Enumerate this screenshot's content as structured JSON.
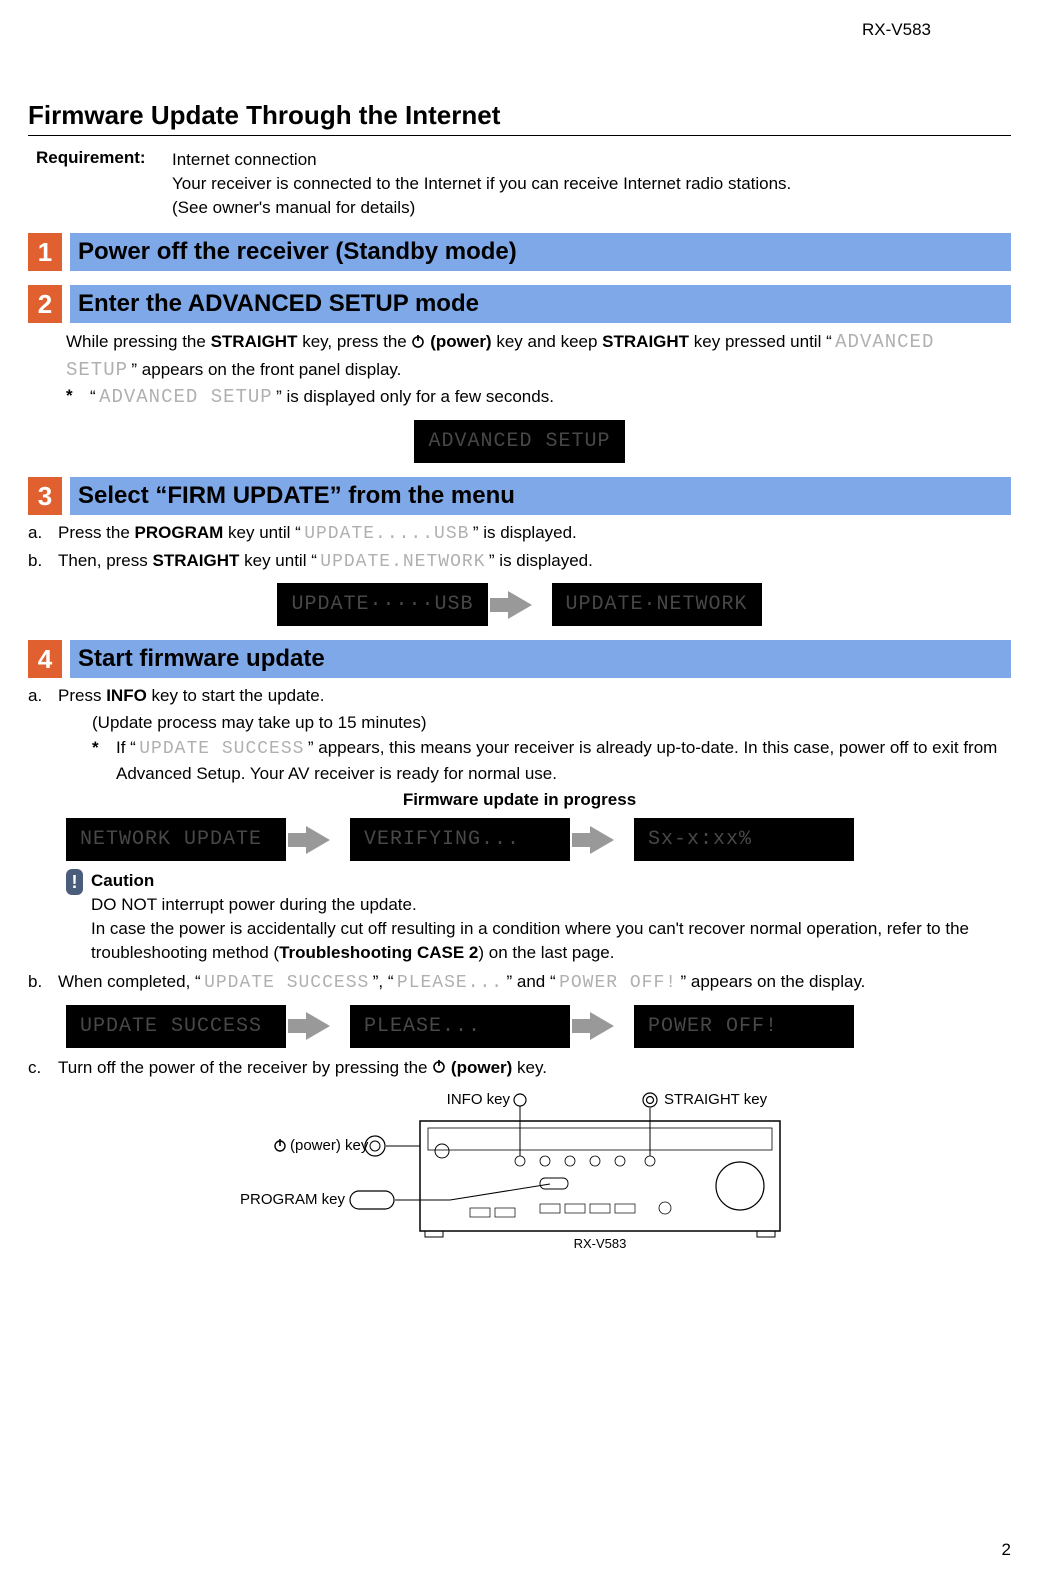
{
  "model": "RX-V583",
  "title": "Firmware Update Through the Internet",
  "requirement": {
    "label": "Requirement:",
    "line1": "Internet connection",
    "line2": "Your receiver is connected to the Internet if you can receive Internet radio stations.",
    "line3": "(See owner's manual for details)"
  },
  "steps": {
    "s1": {
      "num": "1",
      "title": "Power off the receiver (Standby mode)"
    },
    "s2": {
      "num": "2",
      "title": "Enter the ADVANCED SETUP mode",
      "para_a": "While pressing the ",
      "para_b": " key, press the ",
      "para_c": " (power)",
      "para_d": " key and keep ",
      "para_e": " key pressed until “ ",
      "para_seg": "ADVANCED SETUP",
      "para_f": " ” appears on the front panel display.",
      "note_a": "“ ",
      "note_seg": "ADVANCED SETUP",
      "note_b": " ” is displayed only for a few seconds.",
      "straight": "STRAIGHT",
      "disp": "ADVANCED SETUP"
    },
    "s3": {
      "num": "3",
      "title": "Select “FIRM UPDATE” from the menu",
      "a_pre": "Press the ",
      "a_key": "PROGRAM",
      "a_mid": " key until “ ",
      "a_seg": "UPDATE.....USB",
      "a_post": " ” is displayed.",
      "b_pre": "Then, press ",
      "b_key": "STRAIGHT",
      "b_mid": " key until “ ",
      "b_seg": "UPDATE.NETWORK",
      "b_post": " ” is displayed.",
      "disp1": "UPDATE·····USB",
      "disp2": "UPDATE·NETWORK"
    },
    "s4": {
      "num": "4",
      "title": "Start firmware update",
      "a_pre": "Press ",
      "a_key": "INFO",
      "a_post": " key to start the update.",
      "a_sub": "(Update process may take up to 15 minutes)",
      "star_pre": "If “ ",
      "star_seg": "UPDATE SUCCESS",
      "star_post": " ” appears, this means your receiver is already up-to-date. In this case, power off to exit from Advanced Setup. Your AV receiver is ready for normal use.",
      "progress_label": "Firmware update in progress",
      "disp1": "NETWORK UPDATE",
      "disp2": "VERIFYING...",
      "disp3": "Sx-x:xx%",
      "caution_title": "Caution",
      "caution_l1": "DO NOT interrupt power during the update.",
      "caution_l2_a": "In case the power is accidentally cut off resulting in a condition where you can't recover normal operation, refer to the troubleshooting method (",
      "caution_l2_b": "Troubleshooting CASE 2",
      "caution_l2_c": ") on the last page.",
      "b_pre": "When completed, “ ",
      "b_seg1": "UPDATE SUCCESS",
      "b_mid1": " ”, “ ",
      "b_seg2": "PLEASE...",
      "b_mid2": " ” and “ ",
      "b_seg3": "POWER OFF!",
      "b_post": " ” appears on the display.",
      "dispB1": "UPDATE SUCCESS",
      "dispB2": "PLEASE...",
      "dispB3": "POWER OFF!",
      "c_pre": "Turn off the power of the receiver by pressing the ",
      "c_power": " (power)",
      "c_post": " key."
    }
  },
  "receiver": {
    "info_key": "INFO key",
    "straight_key": "STRAIGHT key",
    "power_key": "(power) key",
    "program_key": "PROGRAM key",
    "model": "RX-V583"
  },
  "page_num": "2",
  "markers": {
    "a": "a.",
    "b": "b.",
    "c": "c.",
    "star": "*"
  },
  "icons": {
    "caution": "!"
  }
}
